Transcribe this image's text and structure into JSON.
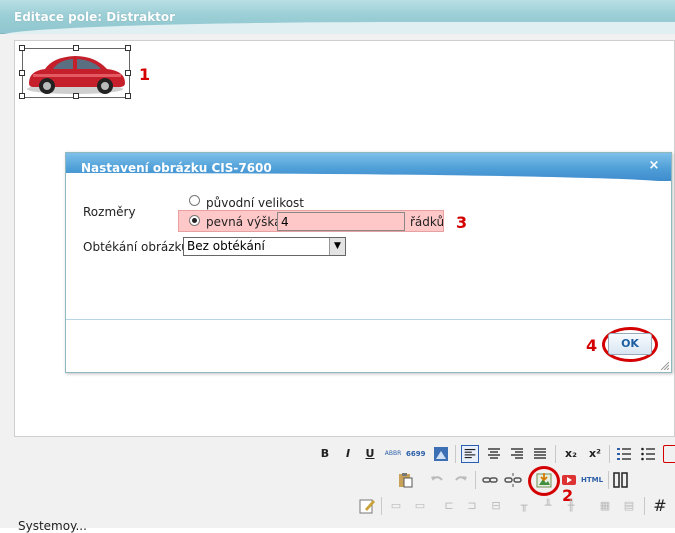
{
  "window": {
    "title": "Editace pole: Distraktor"
  },
  "annotations": {
    "step1": "1",
    "step2": "2",
    "step3": "3",
    "step4": "4"
  },
  "dialog": {
    "title": "Nastavení obrázku CIS-7600",
    "close_icon": "×",
    "dimensions_label": "Rozměry",
    "option_original": "původní velikost",
    "option_fixed_height": "pevná výška",
    "height_value": "4",
    "height_unit": "řádků",
    "wrap_label": "Obtékání obrázku",
    "wrap_selected": "Bez obtékání",
    "ok_label": "OK"
  },
  "toolbar": {
    "row1": [
      "B",
      "I",
      "U",
      "ABBR",
      "6699",
      "x₂",
      "x²"
    ],
    "html_label": "HTML"
  },
  "status": {
    "text": "Systemoy..."
  },
  "colors": {
    "title_accent": "#9ccfd6",
    "dialog_title": "#4f9fd8",
    "annotation": "#d40000",
    "highlight": "#ffc8c8"
  }
}
